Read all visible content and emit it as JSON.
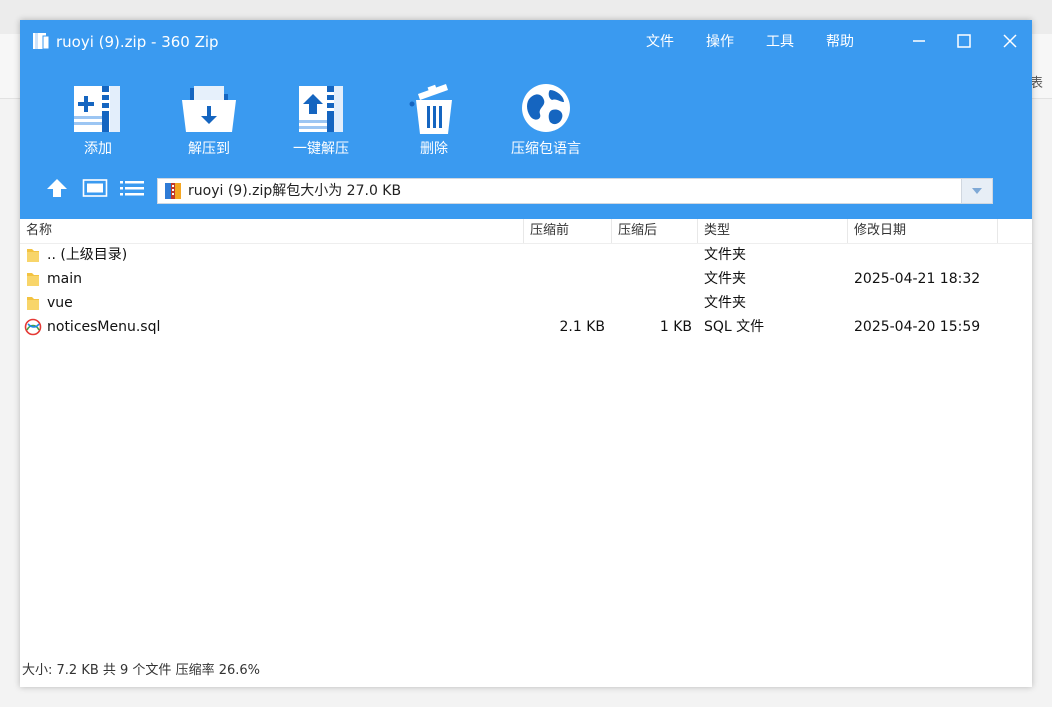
{
  "window": {
    "title": "ruoyi (9).zip - 360 Zip",
    "menu": [
      "文件",
      "操作",
      "工具",
      "帮助"
    ]
  },
  "background": {
    "edge_char": "表"
  },
  "toolbar": {
    "add_label": "添加",
    "extract_to_label": "解压到",
    "one_click_extract_label": "一键解压",
    "delete_label": "删除",
    "language_label": "压缩包语言"
  },
  "pathbar": {
    "text": "ruoyi (9).zip解包大小为 27.0 KB"
  },
  "columns": {
    "name": "名称",
    "before": "压缩前",
    "after": "压缩后",
    "type": "类型",
    "date": "修改日期"
  },
  "files": [
    {
      "name": ".. (上级目录)",
      "before": "",
      "after": "",
      "type": "文件夹",
      "date": "",
      "icon": "folder-icon"
    },
    {
      "name": "main",
      "before": "",
      "after": "",
      "type": "文件夹",
      "date": "2025-04-21 18:32",
      "icon": "folder-icon"
    },
    {
      "name": "vue",
      "before": "",
      "after": "",
      "type": "文件夹",
      "date": "",
      "icon": "folder-icon"
    },
    {
      "name": "noticesMenu.sql",
      "before": "2.1 KB",
      "after": "1 KB",
      "type": "SQL 文件",
      "date": "2025-04-20 15:59",
      "icon": "sql-file-icon"
    }
  ],
  "status": {
    "text": "大小: 7.2 KB 共 9 个文件 压缩率 26.6%"
  },
  "colors": {
    "header_blue": "#3a9af0",
    "icon_dark_blue": "#1565c0"
  }
}
